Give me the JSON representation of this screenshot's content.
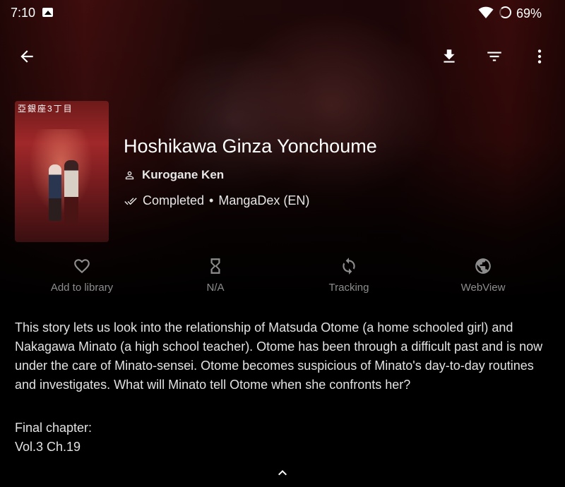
{
  "status_bar": {
    "time": "7:10",
    "battery": "69%"
  },
  "toolbar": {
    "back_icon": "arrow-back-icon",
    "download_icon": "download-icon",
    "filter_icon": "filter-icon",
    "more_icon": "more-vert-icon"
  },
  "cover_text": "亞銀座3丁目",
  "manga": {
    "title": "Hoshikawa Ginza Yonchoume",
    "author": "Kurogane Ken",
    "status": "Completed",
    "separator": "•",
    "source": "MangaDex (EN)"
  },
  "actions": [
    {
      "label": "Add to library",
      "icon": "heart-outline-icon"
    },
    {
      "label": "N/A",
      "icon": "hourglass-icon"
    },
    {
      "label": "Tracking",
      "icon": "sync-icon"
    },
    {
      "label": "WebView",
      "icon": "globe-icon"
    }
  ],
  "description": "This story lets us look into the relationship of Matsuda Otome (a home schooled girl) and Nakagawa Minato (a high school teacher). Otome has been through a difficult past and is now under the care of Minato-sensei. Otome becomes suspicious of Minato's day-to-day routines and investigates. What will Minato tell Otome when she confronts her?",
  "final_chapter": {
    "label": "Final chapter:",
    "value": "Vol.3 Ch.19"
  },
  "colors": {
    "background": "#000000",
    "text": "#ffffff",
    "muted": "#8d8d8d"
  }
}
